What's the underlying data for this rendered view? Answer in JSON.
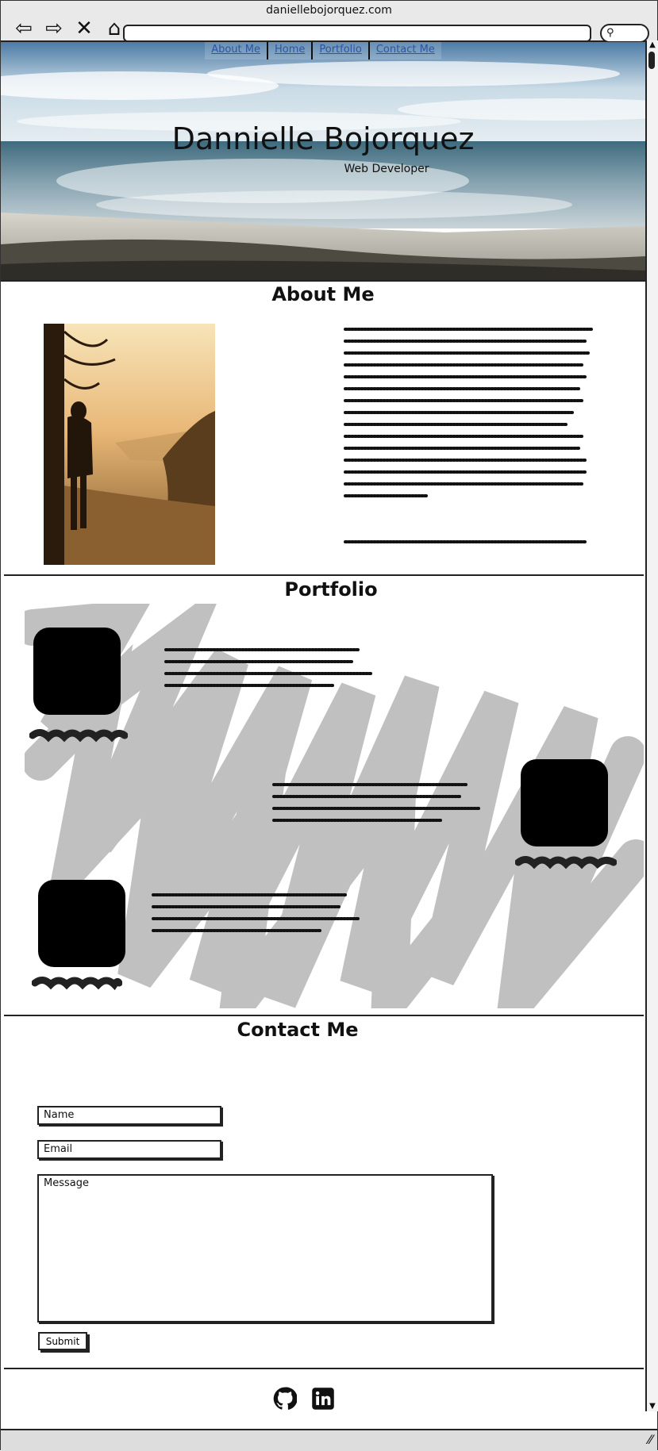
{
  "browser": {
    "url": "daniellebojorquez.com",
    "nav_icons": [
      "back-arrow-icon",
      "forward-arrow-icon",
      "close-icon",
      "home-icon"
    ],
    "search_icon": "search-icon"
  },
  "nav": {
    "links": [
      "About Me",
      "Home",
      "Portfolio",
      "Contact Me"
    ],
    "link_color": "#2a55a8"
  },
  "hero": {
    "title": "Dannielle Bojorquez",
    "subtitle": "Web Developer"
  },
  "about": {
    "heading": "About Me",
    "photo_icon": "person-photo"
  },
  "portfolio": {
    "heading": "Portfolio"
  },
  "contact": {
    "heading": "Contact Me",
    "name_placeholder": "Name",
    "email_placeholder": "Email",
    "message_placeholder": "Message",
    "submit_label": "Submit"
  },
  "footer": {
    "icons": [
      "github-icon",
      "linkedin-icon"
    ]
  }
}
